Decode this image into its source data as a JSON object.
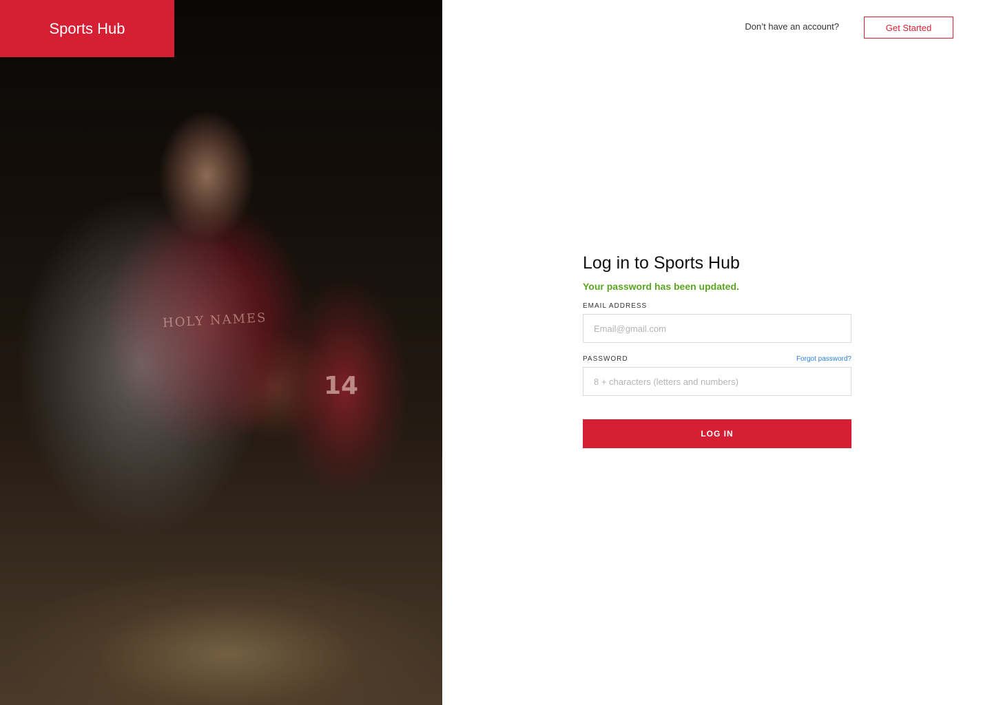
{
  "brand": {
    "name": "Sports Hub",
    "color": "#d71f33"
  },
  "hero": {
    "image_icon": "basketball-photo",
    "jersey_text": "HOLY NAMES",
    "jersey_number": "14"
  },
  "topbar": {
    "prompt_text": "Don’t have an account?",
    "cta_label": "Get Started"
  },
  "login": {
    "title": "Log in to Sports Hub",
    "success_message": "Your password has been updated.",
    "success_color": "#5aa620",
    "email": {
      "label": "EMAIL ADDRESS",
      "placeholder": "Email@gmail.com",
      "value": ""
    },
    "password": {
      "label": "PASSWORD",
      "placeholder": "8 + characters (letters and numbers)",
      "value": ""
    },
    "forgot_link": "Forgot password?",
    "submit_label": "LOG IN"
  }
}
